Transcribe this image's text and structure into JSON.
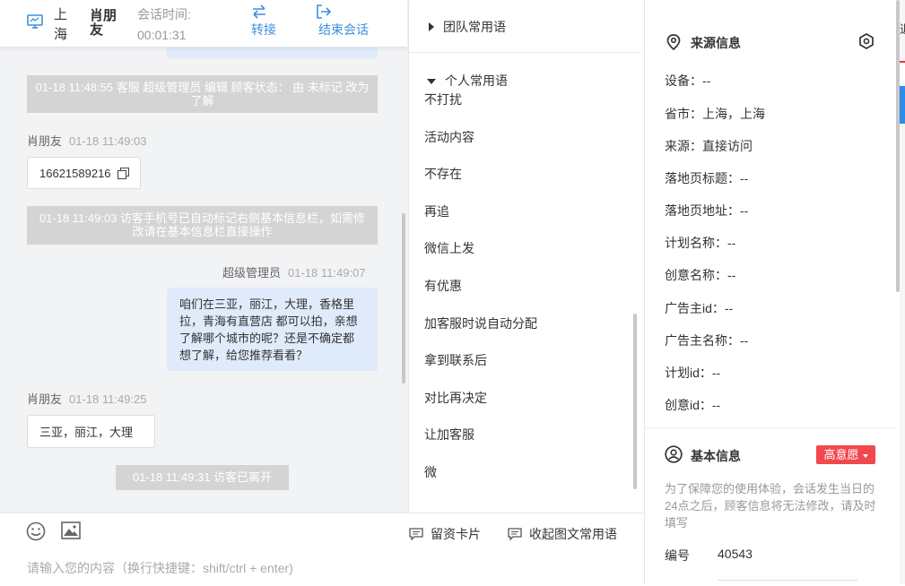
{
  "header": {
    "location": "上海",
    "visitor_name": "肖朋友",
    "time_label": "会话时间:",
    "time_value": "00:01:31",
    "transfer_label": "转接",
    "end_label": "结束会话"
  },
  "chat": {
    "sys1": "01-18 11:48:55 客服 超级管理员 编辑 顾客状态： 由 未标记 改为 了解",
    "msg1": {
      "sender": "肖朋友",
      "time": "01-18 11:49:03",
      "text": "16621589216"
    },
    "sys2": "01-18 11:49:03 访客手机号已自动标记右侧基本信息栏，如需修改请在基本信息栏直接操作",
    "msg2": {
      "sender": "超级管理员",
      "time": "01-18 11:49:07",
      "text": "咱们在三亚，丽江，大理，香格里拉，青海有直营店 都可以拍，亲想了解哪个城市的呢？还是不确定都想了解，给您推荐看看？"
    },
    "msg3": {
      "sender": "肖朋友",
      "time": "01-18 11:49:25",
      "text": "三亚，丽江，大理"
    },
    "sys3": "01-18 11:49:31 访客已离开"
  },
  "input": {
    "placeholder": "请输入您的内容（换行快捷键：shift/ctrl + enter)",
    "card_label": "留资卡片",
    "collapse_label": "收起图文常用语"
  },
  "phrases": {
    "team_label": "团队常用语",
    "personal_label": "个人常用语",
    "items": [
      "不打扰",
      "活动内容",
      "不存在",
      "再追",
      "微信上发",
      "有优惠",
      "加客服时说自动分配",
      "拿到联系后",
      "对比再决定",
      "让加客服",
      "微"
    ]
  },
  "source": {
    "title": "来源信息",
    "rows": [
      "设备：--",
      "省市：上海，上海",
      "来源：直接访问",
      "落地页标题：--",
      "落地页地址：--",
      "计划名称：--",
      "创意名称：--",
      "广告主id：--",
      "广告主名称：--",
      "计划id：--",
      "创意id：--"
    ]
  },
  "basic": {
    "title": "基本信息",
    "badge": "高意愿",
    "note": "为了保障您的使用体验，会话发生当日的24点之后，顾客信息将无法修改，请及时填写",
    "id_label": "编号",
    "id_value": "40543"
  },
  "edge": {
    "char": "退"
  },
  "colors": {
    "accent": "#3d8fe0",
    "badge": "#f0484e",
    "bubble_right": "#dfeafb",
    "system_bg": "#d4d4d4"
  }
}
